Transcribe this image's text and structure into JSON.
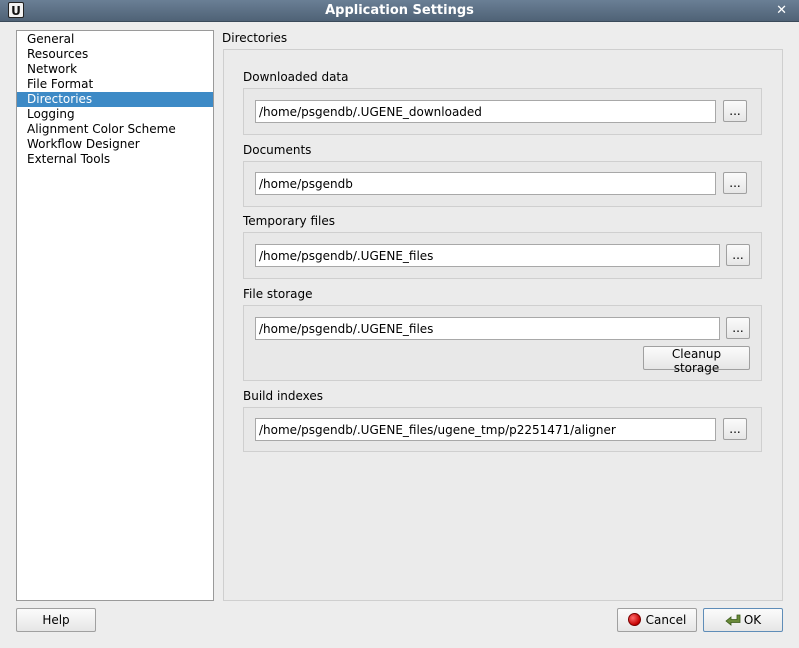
{
  "window": {
    "title": "Application Settings",
    "logo": "U"
  },
  "nav": {
    "items": [
      "General",
      "Resources",
      "Network",
      "File Format",
      "Directories",
      "Logging",
      "Alignment Color Scheme",
      "Workflow Designer",
      "External Tools"
    ],
    "selected": "Directories"
  },
  "section": {
    "title": "Directories"
  },
  "groups": {
    "downloaded": {
      "label": "Downloaded data",
      "path": "/home/psgendb/.UGENE_downloaded"
    },
    "documents": {
      "label": "Documents",
      "path": "/home/psgendb"
    },
    "temporary": {
      "label": "Temporary files",
      "path": "/home/psgendb/.UGENE_files"
    },
    "storage": {
      "label": "File storage",
      "path": "/home/psgendb/.UGENE_files",
      "cleanup_label": "Cleanup storage"
    },
    "indexes": {
      "label": "Build indexes",
      "path": "/home/psgendb/.UGENE_files/ugene_tmp/p2251471/aligner"
    }
  },
  "browse_label": "...",
  "footer": {
    "help_label": "Help",
    "cancel_label": "Cancel",
    "ok_label": "OK"
  },
  "colors": {
    "selection": "#3d8ac6",
    "titlebar": "#5a6e84"
  }
}
